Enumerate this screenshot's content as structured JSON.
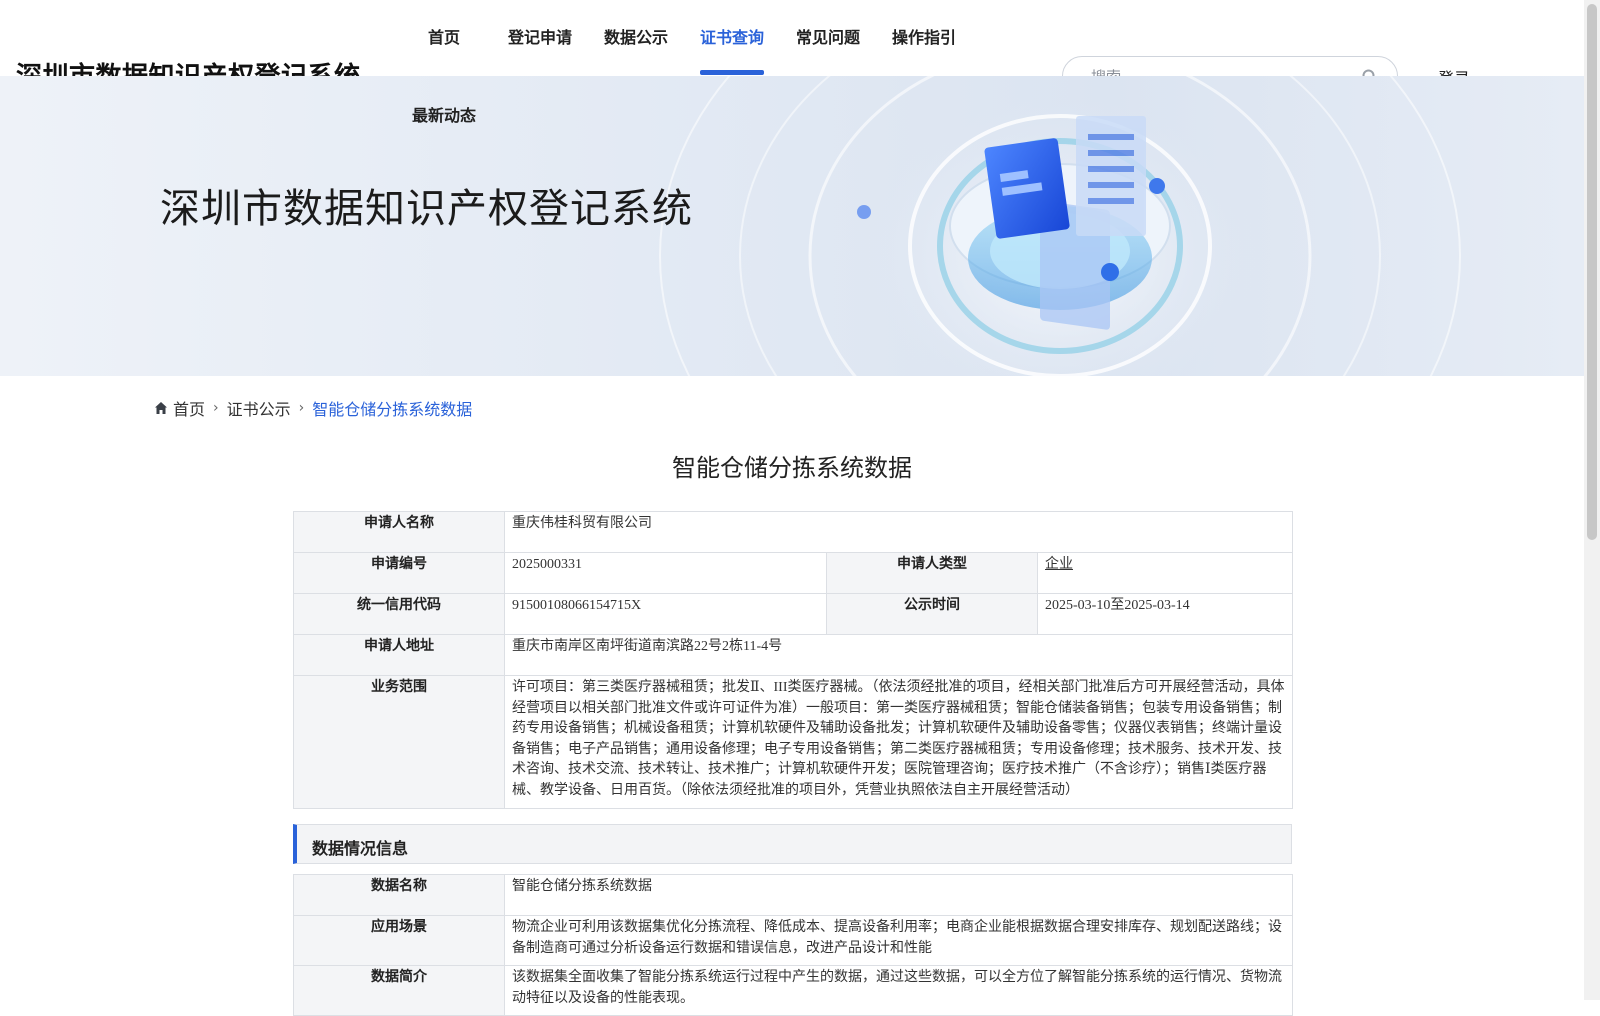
{
  "header": {
    "site_title": "深圳市数据知识产权登记系统",
    "nav": [
      {
        "label": "首页",
        "active": false
      },
      {
        "label": "登记申请",
        "active": false
      },
      {
        "label": "数据公示",
        "active": false
      },
      {
        "label": "证书查询",
        "active": true
      },
      {
        "label": "常见问题",
        "active": false
      },
      {
        "label": "操作指引",
        "active": false
      },
      {
        "label": "最新动态",
        "active": false
      }
    ],
    "search_placeholder": "搜索",
    "login_label": "登录"
  },
  "banner": {
    "title": "深圳市数据知识产权登记系统"
  },
  "breadcrumb": {
    "home": "首页",
    "level2": "证书公示",
    "current": "智能仓储分拣系统数据"
  },
  "page_title": "智能仓储分拣系统数据",
  "applicant": {
    "name_label": "申请人名称",
    "name": "重庆伟桂科贸有限公司",
    "number_label": "申请编号",
    "number": "2025000331",
    "type_label": "申请人类型",
    "type": "企业",
    "credit_code_label": "统一信用代码",
    "credit_code": "91500108066154715X",
    "publicity_label": "公示时间",
    "publicity": "2025-03-10至2025-03-14",
    "address_label": "申请人地址",
    "address": "重庆市南岸区南坪街道南滨路22号2栋11-4号",
    "scope_label": "业务范围",
    "scope": "许可项目：第三类医疗器械租赁；批发Ⅱ、III类医疗器械。（依法须经批准的项目，经相关部门批准后方可开展经营活动，具体经营项目以相关部门批准文件或许可证件为准）一般项目：第一类医疗器械租赁；智能仓储装备销售；包装专用设备销售；制药专用设备销售；机械设备租赁；计算机软硬件及辅助设备批发；计算机软硬件及辅助设备零售；仪器仪表销售；终端计量设备销售；电子产品销售；通用设备修理；电子专用设备销售；第二类医疗器械租赁；专用设备修理；技术服务、技术开发、技术咨询、技术交流、技术转让、技术推广；计算机软硬件开发；医院管理咨询；医疗技术推广（不含诊疗）；销售Ⅰ类医疗器械、教学设备、日用百货。（除依法须经批准的项目外，凭营业执照依法自主开展经营活动）"
  },
  "data_section": {
    "title": "数据情况信息",
    "data_name_label": "数据名称",
    "data_name": "智能仓储分拣系统数据",
    "scenario_label": "应用场景",
    "scenario": "物流企业可利用该数据集优化分拣流程、降低成本、提高设备利用率；电商企业能根据数据合理安排库存、规划配送路线；设备制造商可通过分析设备运行数据和错误信息，改进产品设计和性能",
    "intro_label": "数据简介",
    "intro": "该数据集全面收集了智能分拣系统运行过程中产生的数据，通过这些数据，可以全方位了解智能分拣系统的运行情况、货物流动特征以及设备的性能表现。"
  },
  "colors": {
    "accent": "#2a62d9",
    "label_bg": "#f4f5f7",
    "border": "#dcdfe4"
  },
  "icons": [
    "search-icon",
    "home-icon",
    "chevron-right-icon"
  ]
}
